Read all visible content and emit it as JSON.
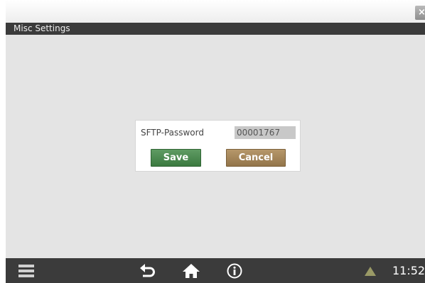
{
  "window": {
    "close_glyph": "×",
    "title": "Misc Settings"
  },
  "dialog": {
    "password_label": "SFTP-Password",
    "password_value": "00001767",
    "save_label": "Save",
    "cancel_label": "Cancel"
  },
  "taskbar": {
    "icons": [
      "menu-icon",
      "back-icon",
      "home-icon",
      "info-icon",
      "warning-icon"
    ],
    "clock": "11:52"
  },
  "colors": {
    "save": "#3f7d44",
    "cancel": "#9c7e52",
    "bar": "#3b3b3b",
    "background": "#e4e4e4"
  }
}
